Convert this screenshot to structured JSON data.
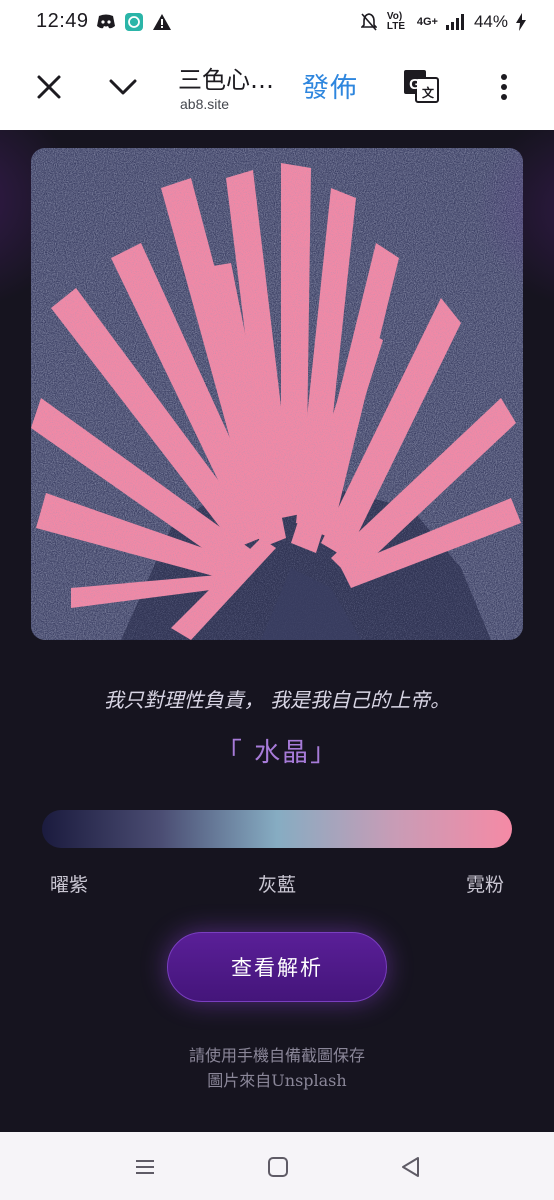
{
  "status_bar": {
    "time": "12:49",
    "left_icons": [
      "discord-icon",
      "chat-bubble-icon",
      "warning-icon"
    ],
    "right_icons": [
      "bell-off-icon",
      "volte-icon",
      "4g-signal-icon",
      "signal-bars-icon",
      "battery-charging-icon"
    ],
    "volte_text": "Vo) LTE",
    "network_text": "4G+",
    "battery": "44%"
  },
  "browser": {
    "title": "三色心…",
    "url": "ab8.site",
    "publish_label": "發佈",
    "icons": {
      "close": "close-icon",
      "collapse": "chevron-down-icon",
      "translate": "translate-icon",
      "more": "more-vert-icon"
    }
  },
  "page": {
    "image_description_icon": "crystal-photo",
    "quote": "我只對理性負責， 我是我自己的上帝。",
    "crystal_name": "「 水晶」",
    "color_scale": {
      "colors": [
        "#1b1b3e",
        "#4a4c72",
        "#86acc2",
        "#c89cb6",
        "#f58aa5"
      ],
      "labels": [
        "曜紫",
        "灰藍",
        "霓粉"
      ]
    },
    "button_label": "查看解析",
    "hint_line1": "請使用手機自備截圖保存",
    "hint_line2": "圖片來自Unsplash"
  },
  "nav_bar": {
    "icons": [
      "recent-apps-icon",
      "home-icon",
      "back-icon"
    ]
  }
}
